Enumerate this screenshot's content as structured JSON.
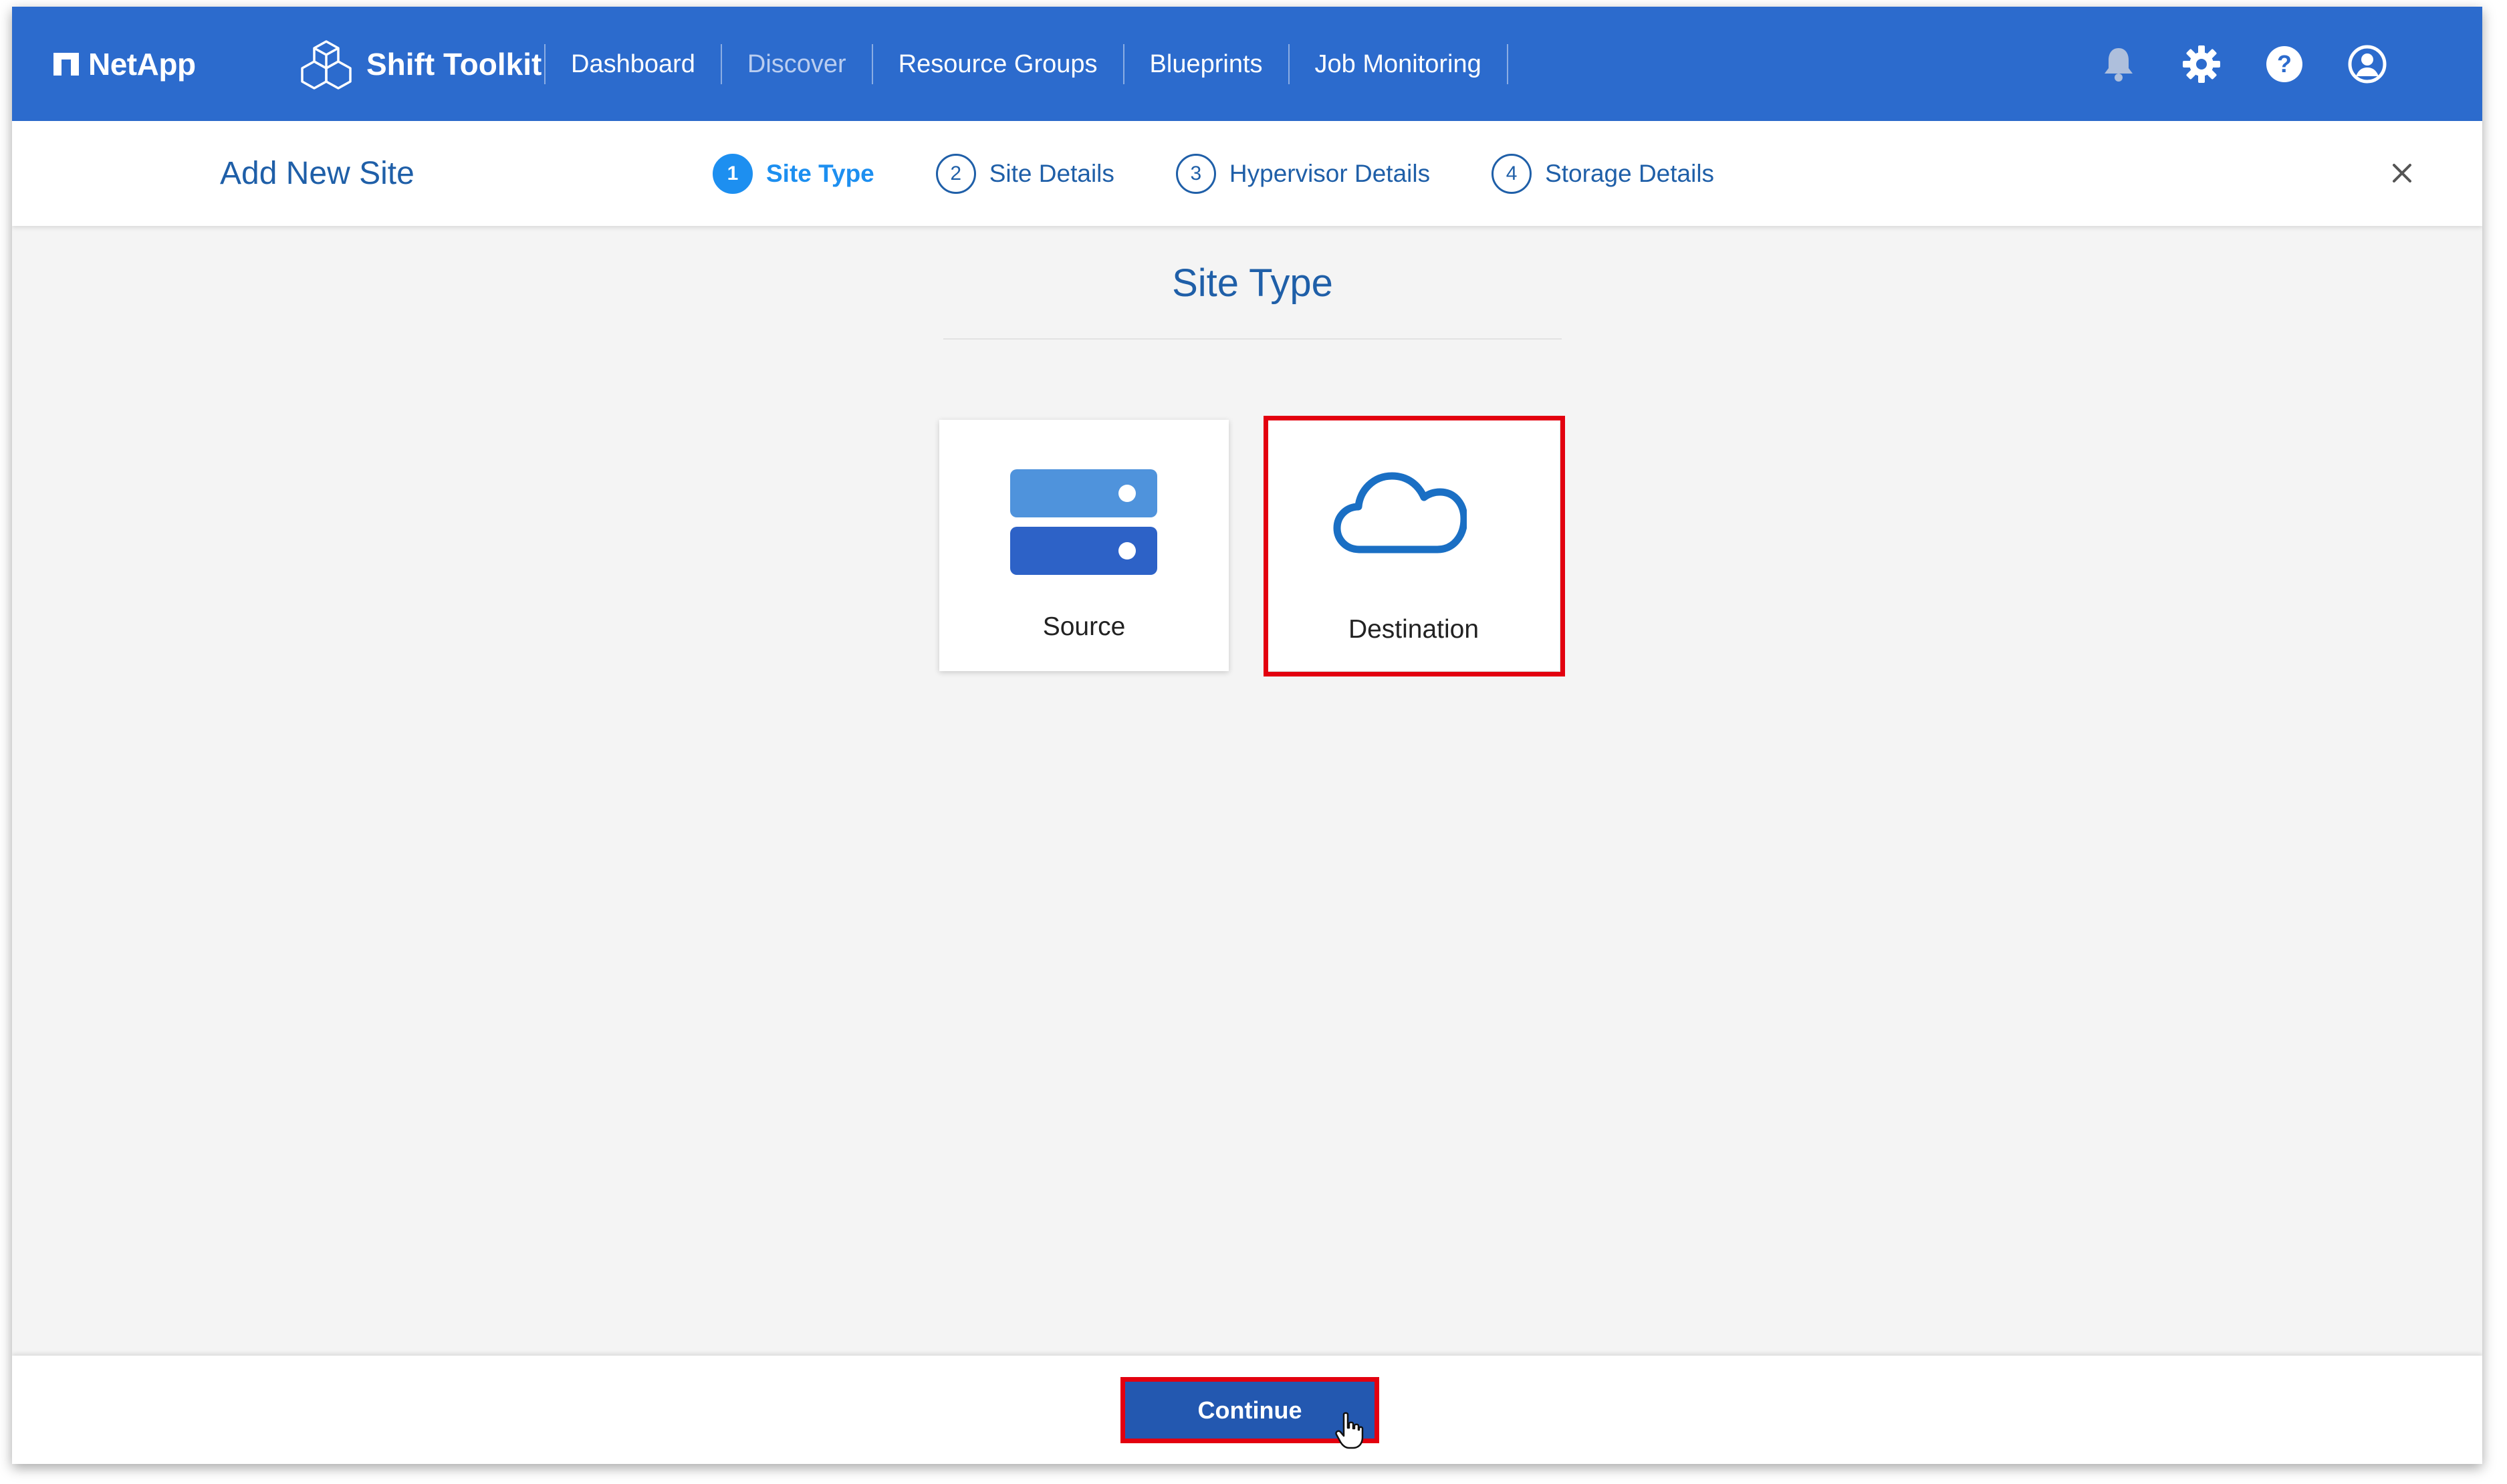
{
  "brand": {
    "name": "NetApp"
  },
  "product": {
    "name": "Shift Toolkit"
  },
  "nav": [
    {
      "label": "Dashboard",
      "active": false
    },
    {
      "label": "Discover",
      "active": true
    },
    {
      "label": "Resource Groups",
      "active": false
    },
    {
      "label": "Blueprints",
      "active": false
    },
    {
      "label": "Job Monitoring",
      "active": false
    }
  ],
  "top_icons": [
    "bell-icon",
    "gear-icon",
    "help-icon",
    "user-icon"
  ],
  "wizard": {
    "title": "Add New Site",
    "steps": [
      {
        "num": "1",
        "label": "Site Type",
        "active": true
      },
      {
        "num": "2",
        "label": "Site Details",
        "active": false
      },
      {
        "num": "3",
        "label": "Hypervisor Details",
        "active": false
      },
      {
        "num": "4",
        "label": "Storage Details",
        "active": false
      }
    ],
    "close_icon": "close-icon"
  },
  "main": {
    "section_title": "Site Type",
    "options": [
      {
        "label": "Source",
        "icon": "server-icon",
        "selected": false
      },
      {
        "label": "Destination",
        "icon": "cloud-icon",
        "selected": true
      }
    ]
  },
  "footer": {
    "continue_label": "Continue"
  },
  "colors": {
    "header_bg": "#2c6bcd",
    "accent_blue": "#1d8ff0",
    "title_blue": "#1f5fa8",
    "button_bg": "#2358b0",
    "highlight_red": "#e3000f"
  }
}
